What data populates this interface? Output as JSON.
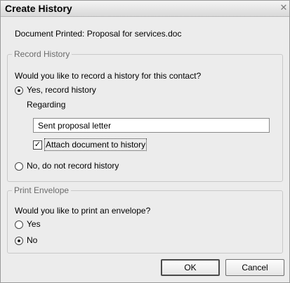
{
  "window": {
    "title": "Create History",
    "close_icon": "close-icon"
  },
  "document_printed": "Document Printed: Proposal for services.doc",
  "record_history": {
    "legend": "Record History",
    "question": "Would you like to record a history for this contact?",
    "yes_label": "Yes, record history",
    "yes_selected": true,
    "regarding_label": "Regarding",
    "regarding_value": "Sent proposal letter",
    "attach_label": "Attach document to history",
    "attach_checked": true,
    "no_label": "No, do not record history",
    "no_selected": false
  },
  "print_envelope": {
    "legend": "Print Envelope",
    "question": "Would you like to print an envelope?",
    "yes_label": "Yes",
    "yes_selected": false,
    "no_label": "No",
    "no_selected": true
  },
  "buttons": {
    "ok": "OK",
    "cancel": "Cancel"
  }
}
